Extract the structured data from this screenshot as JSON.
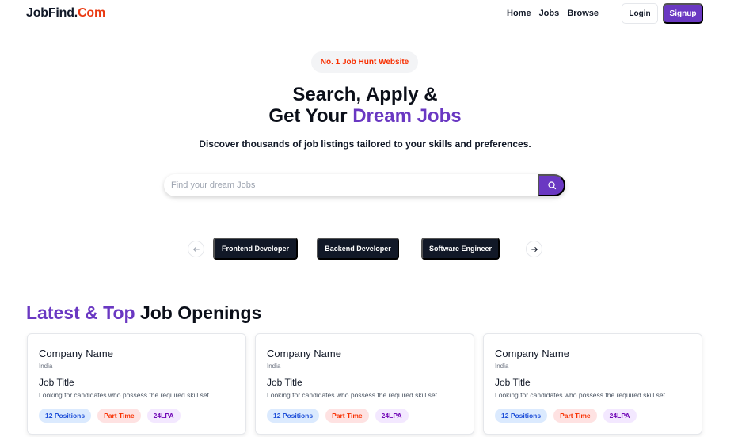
{
  "navbar": {
    "logo_part1": "JobFind.",
    "logo_part2": "Com",
    "links": [
      "Home",
      "Jobs",
      "Browse"
    ],
    "login_label": "Login",
    "signup_label": "Signup"
  },
  "hero": {
    "badge": "No. 1 Job Hunt Website",
    "title_line1": "Search, Apply &",
    "title_line2_prefix": "Get Your ",
    "title_line2_accent": "Dream Jobs",
    "subtitle": "Discover thousands of job listings tailored to your skills and preferences."
  },
  "search": {
    "placeholder": "Find your dream Jobs",
    "value": "",
    "button_icon": "search-icon"
  },
  "carousel": {
    "prev_icon": "arrow-left-icon",
    "next_icon": "arrow-right-icon",
    "categories": [
      "Frontend Developer",
      "Backend Developer",
      "Software Engineer"
    ]
  },
  "latest": {
    "title_accent": "Latest & Top",
    "title_rest": " Job Openings",
    "cards": [
      {
        "company": "Company Name",
        "location": "India",
        "title": "Job Title",
        "description": "Looking for candidates who possess the required skill set",
        "positions": "12 Positions",
        "type": "Part Time",
        "salary": "24LPA"
      },
      {
        "company": "Company Name",
        "location": "India",
        "title": "Job Title",
        "description": "Looking for candidates who possess the required skill set",
        "positions": "12 Positions",
        "type": "Part Time",
        "salary": "24LPA"
      },
      {
        "company": "Company Name",
        "location": "India",
        "title": "Job Title",
        "description": "Looking for candidates who possess the required skill set",
        "positions": "12 Positions",
        "type": "Part Time",
        "salary": "24LPA"
      }
    ]
  },
  "colors": {
    "brand_purple": "#6a38c2",
    "brand_orange": "#f83002",
    "dark": "#111827"
  }
}
